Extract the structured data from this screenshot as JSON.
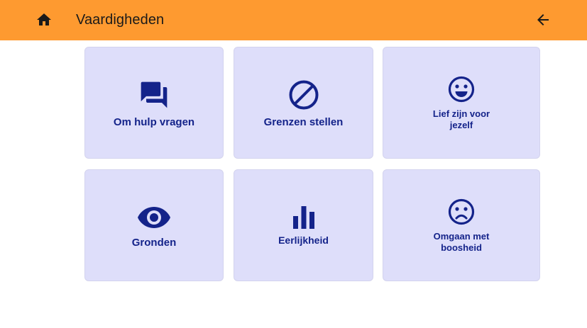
{
  "app_bar": {
    "title": "Vaardigheden",
    "home_icon": "home-icon",
    "back_icon": "arrow-back-icon",
    "background": "#fe9a30"
  },
  "skills": [
    {
      "label": "Om hulp vragen",
      "icon": "chat-bubbles-icon"
    },
    {
      "label": "Grenzen stellen",
      "icon": "block-icon"
    },
    {
      "label_lines": [
        "Lief zijn voor",
        "jezelf"
      ],
      "icon": "smiley-icon"
    },
    {
      "label": "Gronden",
      "icon": "eye-icon"
    },
    {
      "label": "Eerlijkheid",
      "icon": "bar-chart-icon"
    },
    {
      "label_lines": [
        "Omgaan met",
        "boosheid"
      ],
      "icon": "sad-face-icon"
    }
  ],
  "colors": {
    "card_background": "#dedefa",
    "accent": "#14238a"
  }
}
